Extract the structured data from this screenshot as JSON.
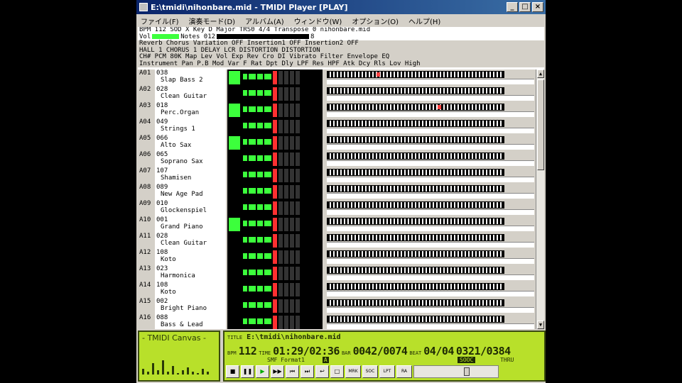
{
  "window": {
    "title": "E:\\tmidi\\nihonbare.mid - TMIDI Player [PLAY]",
    "buttons": {
      "minimize": "_",
      "maximize": "□",
      "close": "×"
    }
  },
  "menu": [
    "ファイル(F)",
    "演奏モード(D)",
    "アルバム(A)",
    "ウィンドウ(W)",
    "オプション(O)",
    "ヘルプ(H)"
  ],
  "info": {
    "row1": "BPM 112 SOD X Key  D Major TRS0    4/4 Transpose 0   nihonbare.mid",
    "vol_label": "Vol",
    "notes_label": "Notes 012",
    "notes_val": "8",
    "row3": "Reverb              Chorus          Variation   OFF Insertion1  OFF Insertion2  OFF",
    "row4": "HALL 1              CHORUS 1        DELAY LCR       DISTORTION      DISTORTION",
    "row5": "CH# PCM 80K Map     Lev Vol Exp Rev Cro DI   Vibrato    Filter   Envelope EQ",
    "row6": "    Instrument          Pan P.B Mod Var F  Rat Dpt Dly LPF Res HPF Atk Dcy Rls Lov High"
  },
  "channels": [
    {
      "id": "A01",
      "prog": "038",
      "name": "Slap Bass 2"
    },
    {
      "id": "A02",
      "prog": "028",
      "name": "Clean Guitar"
    },
    {
      "id": "A03",
      "prog": "018",
      "name": "Perc.Organ"
    },
    {
      "id": "A04",
      "prog": "049",
      "name": "Strings 1"
    },
    {
      "id": "A05",
      "prog": "066",
      "name": "Alto Sax"
    },
    {
      "id": "A06",
      "prog": "065",
      "name": "Soprano Sax"
    },
    {
      "id": "A07",
      "prog": "107",
      "name": "Shamisen"
    },
    {
      "id": "A08",
      "prog": "089",
      "name": "New Age Pad"
    },
    {
      "id": "A09",
      "prog": "010",
      "name": "Glockenspiel"
    },
    {
      "id": "A10",
      "prog": "001",
      "name": "Grand Piano"
    },
    {
      "id": "A11",
      "prog": "028",
      "name": "Clean Guitar"
    },
    {
      "id": "A12",
      "prog": "108",
      "name": "Koto"
    },
    {
      "id": "A13",
      "prog": "023",
      "name": "Harmonica"
    },
    {
      "id": "A14",
      "prog": "108",
      "name": "Koto"
    },
    {
      "id": "A15",
      "prog": "002",
      "name": "Bright Piano"
    },
    {
      "id": "A16",
      "prog": "088",
      "name": "Bass & Lead"
    }
  ],
  "canvas": {
    "title": "- TMIDI Canvas -"
  },
  "lcd": {
    "title_label": "TITLE",
    "title": "E:\\tmidi\\nihonbare.mid",
    "bpm_label": "BPM",
    "bpm": "112",
    "time_label": "TIME",
    "time": "01:29/02:36",
    "bar_label": "BAR",
    "bar": "0042/0074",
    "beat_label": "BEAT",
    "beat": "04/04",
    "tick": "0321/0384",
    "format": "SMF Format1",
    "format_mark": "A",
    "sync": "SOOC",
    "thru": "THRU"
  },
  "controls": [
    "■",
    "❚❚",
    "▶",
    "▶▶",
    "⏮",
    "⏭",
    "↩",
    "□",
    "MRK",
    "SOC",
    "LPT",
    "RA"
  ],
  "colors": {
    "lcd": "#b8e02a",
    "meter": "#3cff3c",
    "title": "#0a246a"
  }
}
